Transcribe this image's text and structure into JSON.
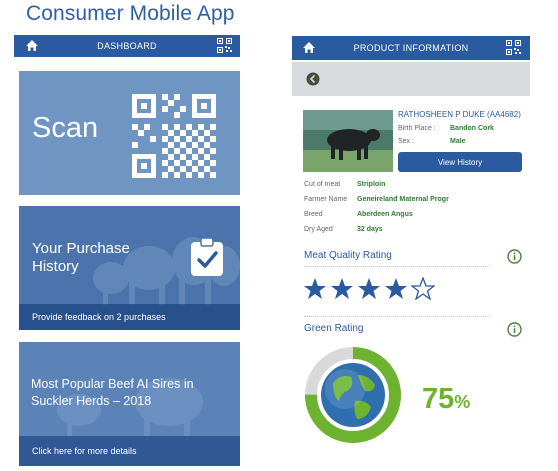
{
  "page": {
    "title": "Consumer Mobile App"
  },
  "dashboard": {
    "header_title": "DASHBOARD",
    "scan_label": "Scan",
    "purchase": {
      "title": "Your Purchase History",
      "footer": "Provide feedback on 2 purchases"
    },
    "popular": {
      "title": "Most Popular Beef AI Sires in Suckler Herds – 2018",
      "footer": "Click here for more details"
    }
  },
  "product": {
    "header_title": "PRODUCT INFORMATION",
    "animal_name": "RATHOSHEEN P DUKE (AA4682)",
    "birth_place_label": "Birth Place :",
    "birth_place": "Bandon Cork",
    "sex_label": "Sex :",
    "sex": "Male",
    "view_history_label": "View History",
    "details": [
      {
        "label": "Cut of meat",
        "value": "Striploin"
      },
      {
        "label": "Farmer Name",
        "value": "Geneireland Maternal Progr"
      },
      {
        "label": "Breed",
        "value": "Aberdeen Angus"
      },
      {
        "label": "Dry Aged",
        "value": "32 days"
      }
    ],
    "meat_quality": {
      "title": "Meat Quality Rating",
      "rating": 4,
      "max": 5
    },
    "green": {
      "title": "Green Rating",
      "percent_text": "75",
      "percent_sign": "%",
      "value": 0.75
    }
  },
  "colors": {
    "brand_blue": "#2a5aa0",
    "green_accent": "#6db330"
  },
  "icons": [
    "home-icon",
    "qr-code-icon",
    "back-arrow-icon",
    "clipboard-check-icon",
    "info-icon",
    "star-icon",
    "globe-icon"
  ]
}
